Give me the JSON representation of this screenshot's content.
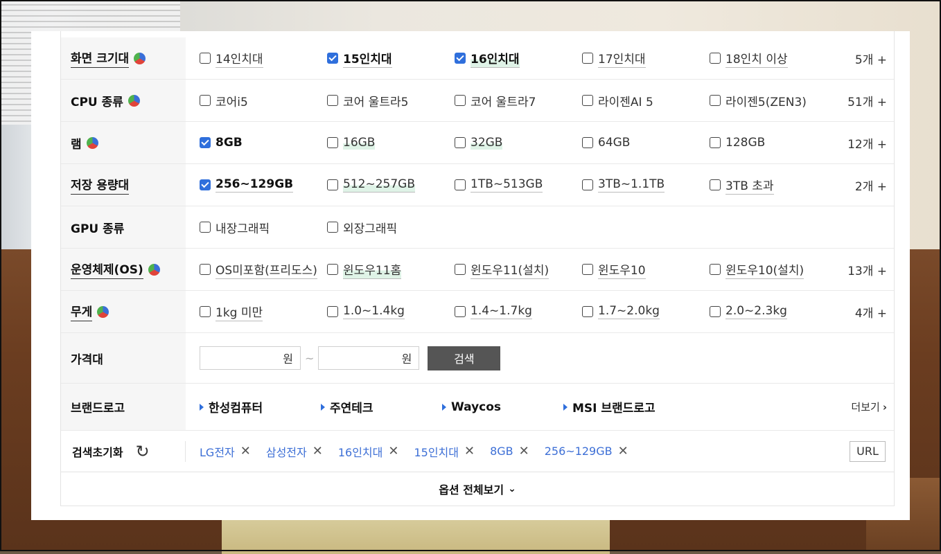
{
  "filters": [
    {
      "label": "화면 크기대",
      "underline": true,
      "pie": true,
      "count": "5개 +",
      "options": [
        {
          "text": "14인치대",
          "checked": false,
          "u": true,
          "hl": false
        },
        {
          "text": "15인치대",
          "checked": true,
          "u": true,
          "hl": false
        },
        {
          "text": "16인치대",
          "checked": true,
          "u": true,
          "hl": true
        },
        {
          "text": "17인치대",
          "checked": false,
          "u": true,
          "hl": false
        },
        {
          "text": "18인치 이상",
          "checked": false,
          "u": true,
          "hl": false
        }
      ]
    },
    {
      "label": "CPU 종류",
      "underline": false,
      "pie": true,
      "count": "51개 +",
      "options": [
        {
          "text": "코어i5",
          "checked": false,
          "u": false,
          "hl": false
        },
        {
          "text": "코어 울트라5",
          "checked": false,
          "u": false,
          "hl": false
        },
        {
          "text": "코어 울트라7",
          "checked": false,
          "u": false,
          "hl": false
        },
        {
          "text": "라이젠AI 5",
          "checked": false,
          "u": false,
          "hl": false
        },
        {
          "text": "라이젠5(ZEN3)",
          "checked": false,
          "u": false,
          "hl": false
        }
      ]
    },
    {
      "label": "램",
      "underline": false,
      "pie": true,
      "count": "12개 +",
      "options": [
        {
          "text": "8GB",
          "checked": true,
          "u": false,
          "hl": false
        },
        {
          "text": "16GB",
          "checked": false,
          "u": false,
          "hl": true
        },
        {
          "text": "32GB",
          "checked": false,
          "u": false,
          "hl": true
        },
        {
          "text": "64GB",
          "checked": false,
          "u": false,
          "hl": false
        },
        {
          "text": "128GB",
          "checked": false,
          "u": false,
          "hl": false
        }
      ]
    },
    {
      "label": "저장 용량대",
      "underline": true,
      "pie": false,
      "count": "2개 +",
      "options": [
        {
          "text": "256~129GB",
          "checked": true,
          "u": true,
          "hl": false
        },
        {
          "text": "512~257GB",
          "checked": false,
          "u": true,
          "hl": true
        },
        {
          "text": "1TB~513GB",
          "checked": false,
          "u": true,
          "hl": false
        },
        {
          "text": "3TB~1.1TB",
          "checked": false,
          "u": true,
          "hl": false
        },
        {
          "text": "3TB 초과",
          "checked": false,
          "u": true,
          "hl": false
        }
      ]
    },
    {
      "label": "GPU 종류",
      "underline": false,
      "pie": false,
      "count": "",
      "options": [
        {
          "text": "내장그래픽",
          "checked": false,
          "u": false,
          "hl": false
        },
        {
          "text": "외장그래픽",
          "checked": false,
          "u": false,
          "hl": false
        }
      ]
    },
    {
      "label": "운영체제(OS)",
      "underline": true,
      "pie": true,
      "count": "13개 +",
      "options": [
        {
          "text": "OS미포함(프리도스)",
          "checked": false,
          "u": true,
          "hl": false
        },
        {
          "text": "윈도우11홈",
          "checked": false,
          "u": true,
          "hl": true
        },
        {
          "text": "윈도우11(설치)",
          "checked": false,
          "u": true,
          "hl": false
        },
        {
          "text": "윈도우10",
          "checked": false,
          "u": true,
          "hl": false
        },
        {
          "text": "윈도우10(설치)",
          "checked": false,
          "u": true,
          "hl": false
        }
      ]
    },
    {
      "label": "무게",
      "underline": true,
      "pie": true,
      "count": "4개 +",
      "options": [
        {
          "text": "1kg 미만",
          "checked": false,
          "u": true,
          "hl": false
        },
        {
          "text": "1.0~1.4kg",
          "checked": false,
          "u": true,
          "hl": false
        },
        {
          "text": "1.4~1.7kg",
          "checked": false,
          "u": true,
          "hl": false
        },
        {
          "text": "1.7~2.0kg",
          "checked": false,
          "u": true,
          "hl": false
        },
        {
          "text": "2.0~2.3kg",
          "checked": false,
          "u": true,
          "hl": false
        }
      ]
    }
  ],
  "price": {
    "label": "가격대",
    "min_suffix": "원",
    "max_suffix": "원",
    "tilde": "~",
    "search_label": "검색"
  },
  "brand_logo": {
    "label": "브랜드로고",
    "items": [
      "한성컴퓨터",
      "주연테크",
      "Waycos",
      "MSI 브랜드로고"
    ],
    "more_label": "더보기"
  },
  "reset": {
    "label": "검색초기화",
    "chips": [
      "LG전자",
      "삼성전자",
      "16인치대",
      "15인치대",
      "8GB",
      "256~129GB"
    ],
    "url_label": "URL"
  },
  "view_all_label": "옵션 전체보기",
  "colors": {
    "accent": "#2f6fdc",
    "chip": "#3d6fd6",
    "button_dark": "#555555"
  }
}
